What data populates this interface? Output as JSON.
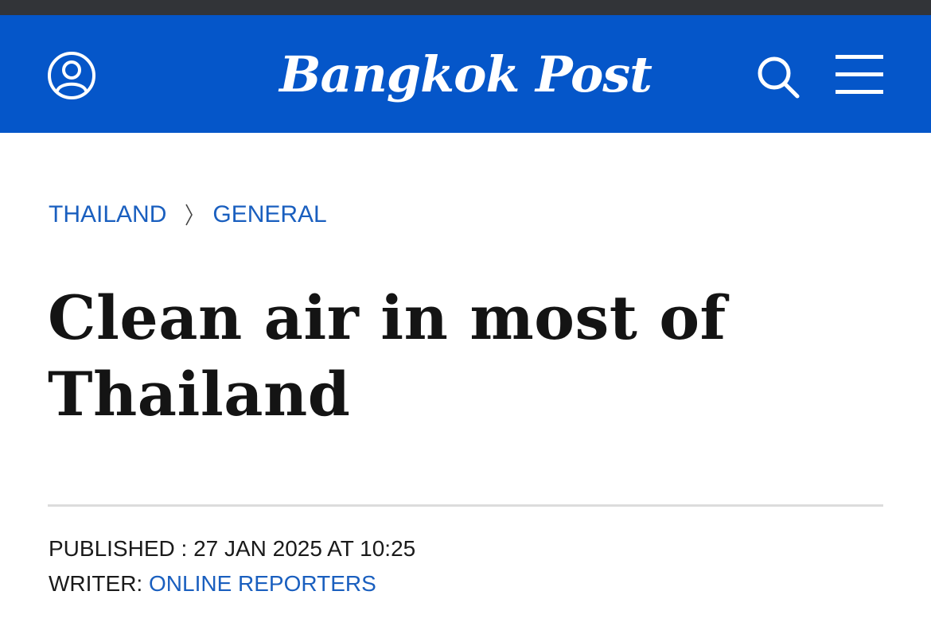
{
  "header": {
    "logo_text": "Bangkok Post",
    "background_color": "#0556c9",
    "icons": {
      "account": "user-circle-icon",
      "search": "search-icon",
      "menu": "hamburger-menu-icon"
    }
  },
  "breadcrumb": {
    "items": [
      "THAILAND",
      "GENERAL"
    ],
    "separator_icon": "chevron-right-icon",
    "link_color": "#1a5fbf"
  },
  "article": {
    "title": "Clean air in most of Thailand",
    "published_label": "PUBLISHED",
    "published_separator": " : ",
    "published_value": "27 JAN 2025 AT 10:25",
    "writer_label": "WRITER: ",
    "writer_name": "ONLINE REPORTERS"
  }
}
